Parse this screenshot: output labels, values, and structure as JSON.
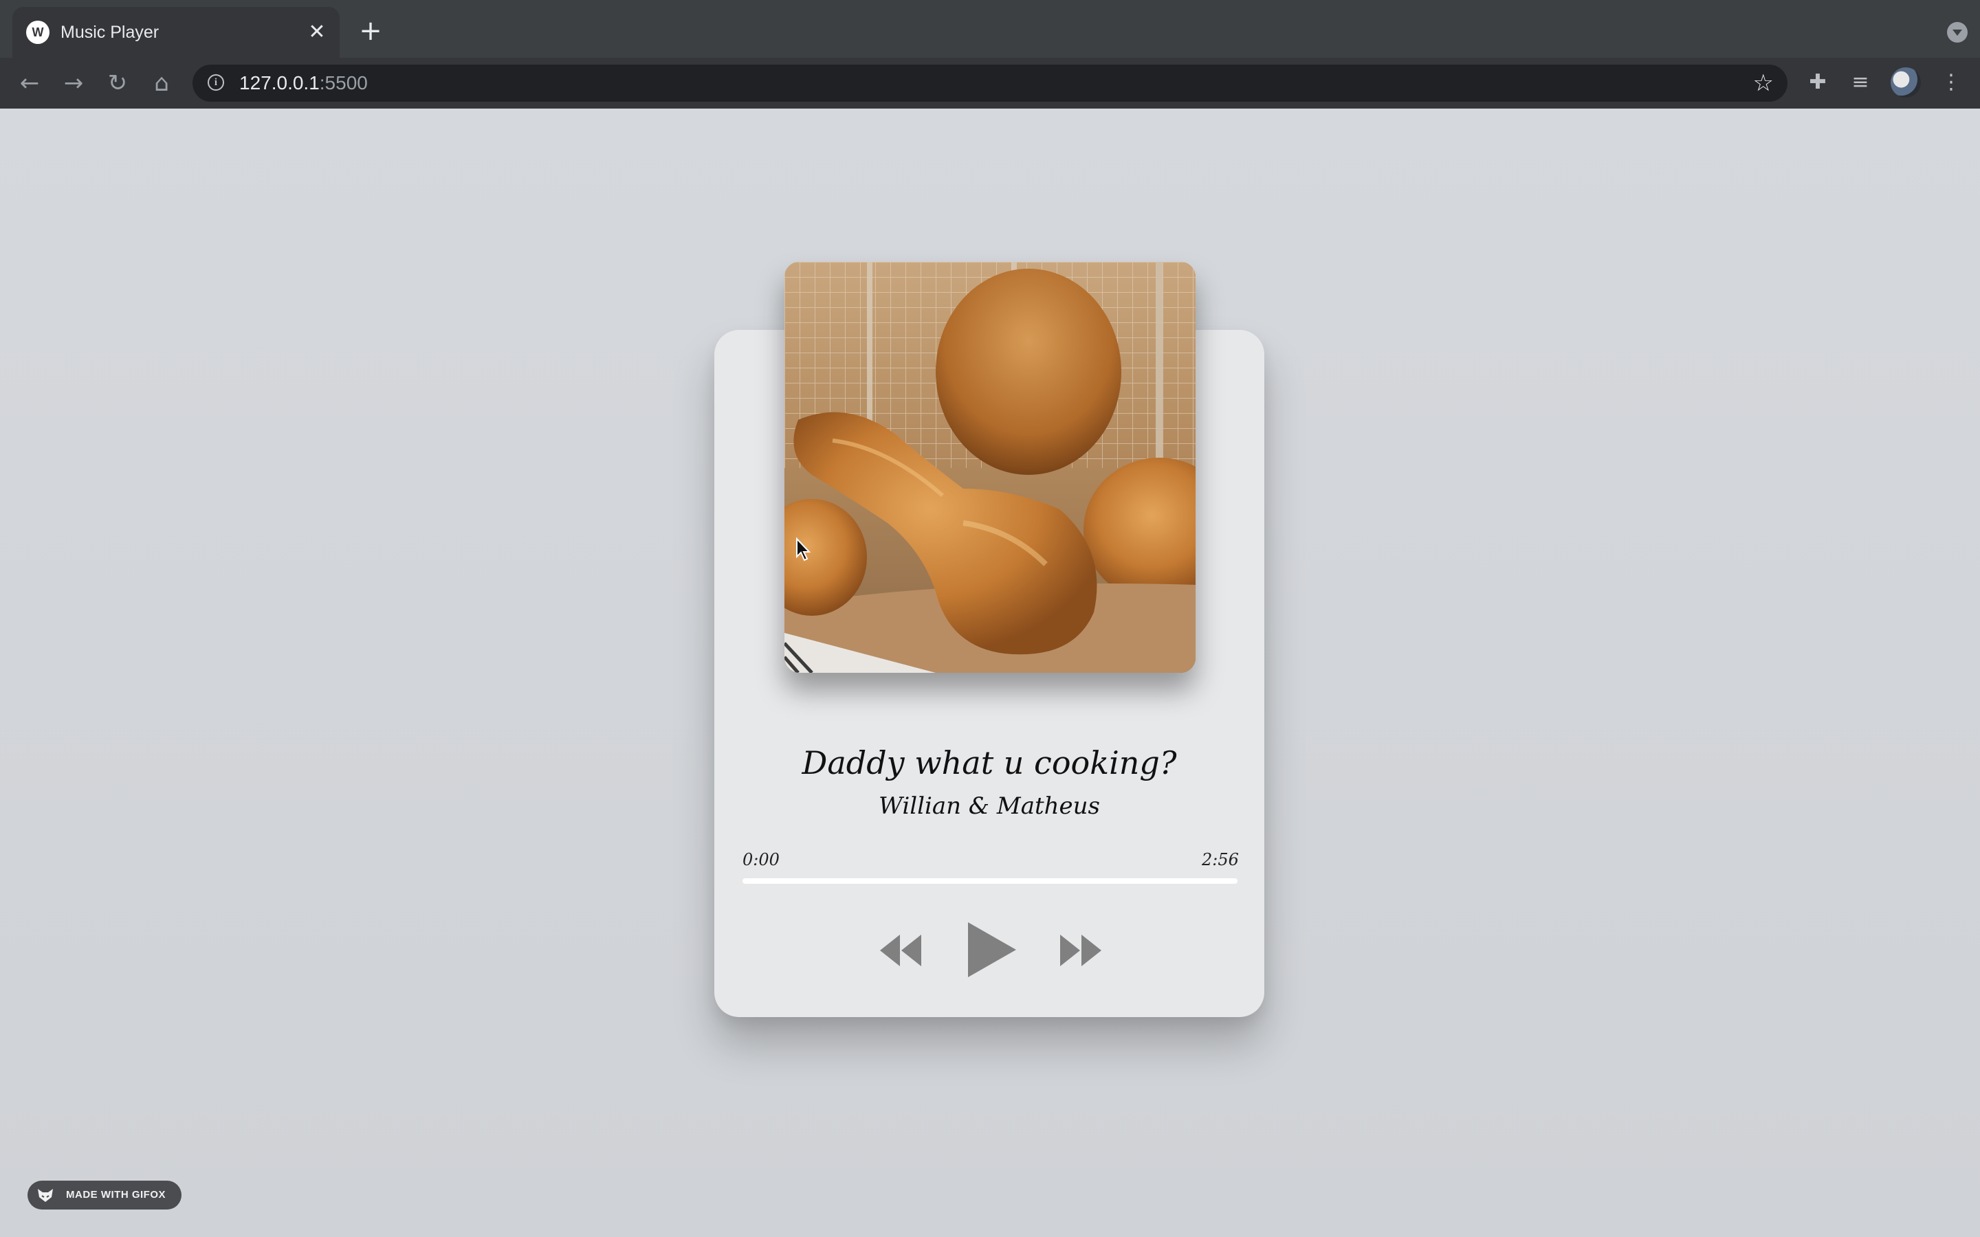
{
  "browser": {
    "tab_title": "Music Player",
    "favicon_text": "W",
    "close_icon": "close-icon",
    "new_tab_icon": "plus-icon",
    "url_host": "127.0.0.1",
    "url_port": ":5500"
  },
  "player": {
    "song_title": "Daddy what u cooking?",
    "artist": "Willian & Matheus",
    "time_current": "0:00",
    "time_total": "2:56",
    "progress": 0,
    "album_art": "fried-chicken-photo",
    "controls": [
      "rewind-icon",
      "play-icon",
      "fast-forward-icon"
    ],
    "control_color": "#808080"
  },
  "badge": {
    "text": "MADE WITH GIFOX"
  }
}
